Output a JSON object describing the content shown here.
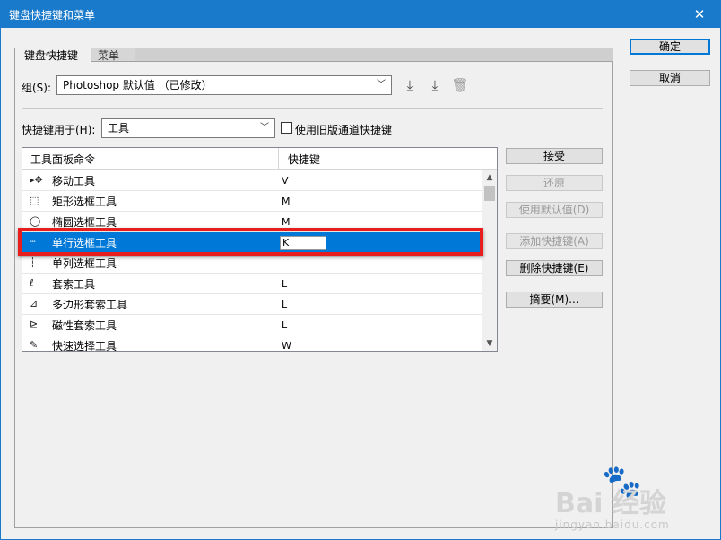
{
  "window": {
    "title": "键盘快捷键和菜单",
    "close_glyph": "✕"
  },
  "tabs": [
    {
      "label": "键盘快捷键"
    },
    {
      "label": "菜单"
    }
  ],
  "group": {
    "label": "组(S):",
    "value": "Photoshop 默认值 （已修改）"
  },
  "shortcuts_for": {
    "label": "快捷键用于(H):",
    "value": "工具",
    "legacy_checkbox_label": "使用旧版通道快捷键",
    "legacy_checked": false
  },
  "table": {
    "headers": [
      "工具面板命令",
      "快捷键"
    ],
    "rows": [
      {
        "icon": "▸✥",
        "icon_name": "move-tool-icon",
        "command": "移动工具",
        "key": "V",
        "selected": false
      },
      {
        "icon": "⬚",
        "icon_name": "rectangular-marquee-icon",
        "command": "矩形选框工具",
        "key": "M",
        "selected": false
      },
      {
        "icon": "◯",
        "icon_name": "elliptical-marquee-icon",
        "command": "椭圆选框工具",
        "key": "M",
        "selected": false
      },
      {
        "icon": "┄",
        "icon_name": "single-row-marquee-icon",
        "command": "单行选框工具",
        "key": "K",
        "selected": true
      },
      {
        "icon": "┆",
        "icon_name": "single-column-marquee-icon",
        "command": "单列选框工具",
        "key": "",
        "selected": false
      },
      {
        "icon": "ℓ",
        "icon_name": "lasso-icon",
        "command": "套索工具",
        "key": "L",
        "selected": false
      },
      {
        "icon": "⊿",
        "icon_name": "polygonal-lasso-icon",
        "command": "多边形套索工具",
        "key": "L",
        "selected": false
      },
      {
        "icon": "⊵",
        "icon_name": "magnetic-lasso-icon",
        "command": "磁性套索工具",
        "key": "L",
        "selected": false
      },
      {
        "icon": "✎",
        "icon_name": "quick-selection-icon",
        "command": "快速选择工具",
        "key": "W",
        "selected": false
      }
    ]
  },
  "side_buttons": {
    "accept": "接受",
    "restore": "还原",
    "use_default": "使用默认值(D)",
    "add_shortcut": "添加快捷键(A)",
    "delete_shortcut": "删除快捷键(E)",
    "summarize": "摘要(M)..."
  },
  "dialog_buttons": {
    "ok": "确定",
    "cancel": "取消"
  },
  "watermark": {
    "brand": "Bai 经验",
    "url": "jingyan.baidu.com"
  },
  "colors": {
    "titlebar": "#1979ca",
    "selection": "#0078d7",
    "highlight_box": "#e81e1e"
  }
}
